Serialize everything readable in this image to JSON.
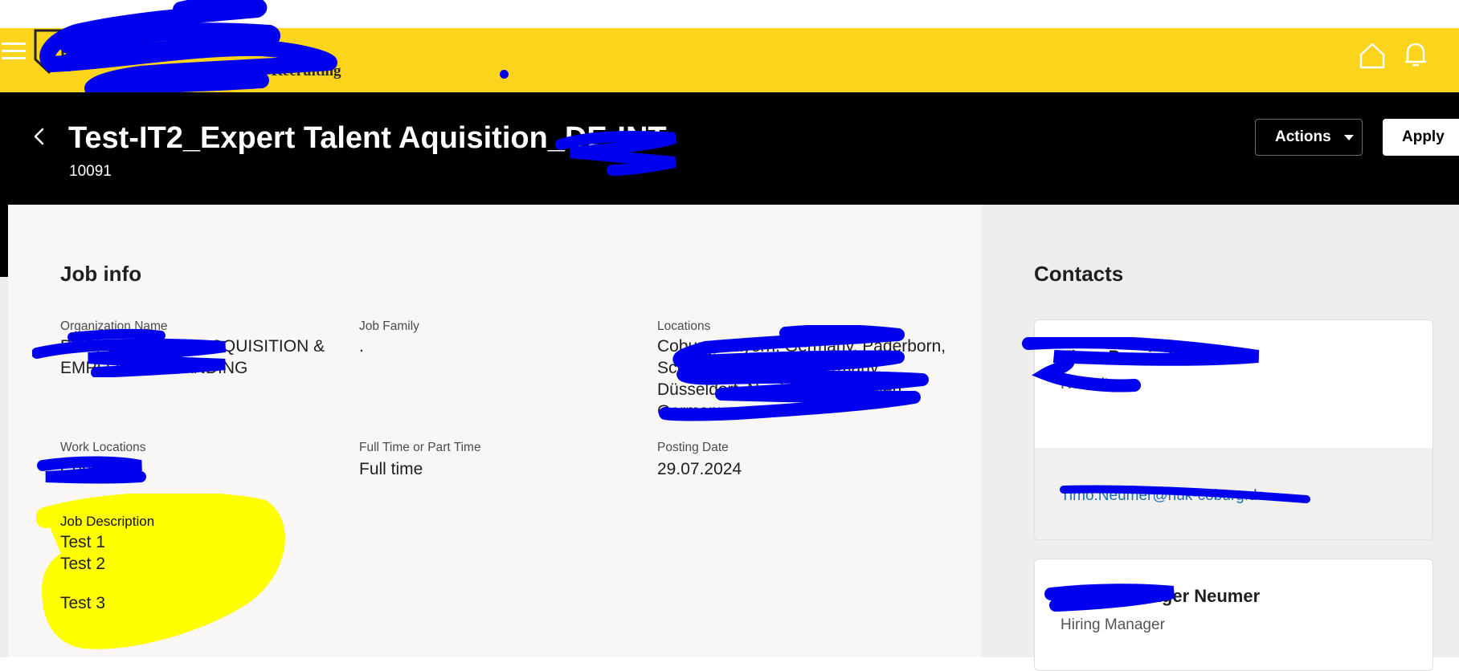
{
  "brand": {
    "logo_text": "HUK-COBURG",
    "logo_subtext": "Recruiting"
  },
  "colors": {
    "appbar": "#fcd41c",
    "header": "#000000",
    "link": "#1e6fb0",
    "redaction": "#0000ee",
    "highlight": "#ffff00"
  },
  "icons": {
    "menu": "hamburger-icon",
    "home": "home-icon",
    "notifications": "bell-icon",
    "back": "chevron-left-icon",
    "actions_caret": "caret-down-icon"
  },
  "job": {
    "title": "Test-IT2_Expert Talent Aquisition_DE-INT",
    "id": "10091"
  },
  "buttons": {
    "actions": "Actions",
    "apply": "Apply"
  },
  "job_info": {
    "title": "Job info",
    "organization_label": "Organization Name",
    "organization_value_line1": "PEOPLE TALENT ACQUISITION &",
    "organization_value_line2": "EMPLOYER BRANDING",
    "job_family_label": "Job Family",
    "job_family_value": ".",
    "locations_label": "Locations",
    "locations_lines": [
      "Coburg, Bayern, Germany, Paderborn,",
      "Schleswig-Holstein, Germany,",
      "Düsseldorf, Nordrhein-Westfalen,",
      "Germany"
    ],
    "work_locations_label": "Work Locations",
    "work_locations_value": "Coburg",
    "fulltime_label": "Full Time or Part Time",
    "fulltime_value": "Full time",
    "posting_date_label": "Posting Date",
    "posting_date_value": "29.07.2024",
    "description_label": "Job Description",
    "description_lines": [
      "Test  1",
      "Test 2",
      "Test 3"
    ]
  },
  "contacts": {
    "title": "Contacts",
    "items": [
      {
        "name": "Timo-Dominik Neumer",
        "role": "Recruiter",
        "email": "Timo.Neumer@huk-coburg.de"
      },
      {
        "name": "Hiring Manager Neumer",
        "role": "Hiring Manager"
      }
    ]
  }
}
